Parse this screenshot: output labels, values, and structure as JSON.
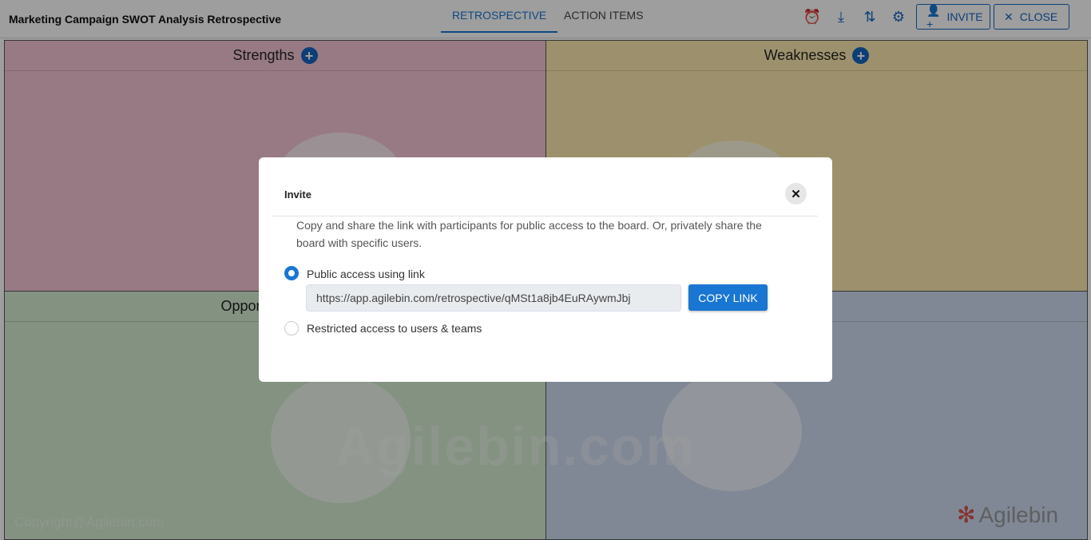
{
  "header": {
    "title": "Marketing Campaign SWOT Analysis Retrospective",
    "tabs": [
      {
        "label": "RETROSPECTIVE",
        "active": true
      },
      {
        "label": "ACTION ITEMS",
        "active": false
      }
    ],
    "icons": [
      "alarm-icon",
      "download-icon",
      "sort-icon",
      "gear-icon"
    ],
    "invite_label": "INVITE",
    "close_label": "CLOSE"
  },
  "board": {
    "quadrants": [
      {
        "label": "Strengths",
        "color": "#f5c6d6"
      },
      {
        "label": "Weaknesses",
        "color": "#fdebb0"
      },
      {
        "label": "Opportunities",
        "color": "#d3ecd0"
      },
      {
        "label": "",
        "color": "#cfdcf2"
      }
    ],
    "watermark": "Agilebin.com",
    "copyright": "Copyright@Agilebin.com",
    "logo": "Agilebin"
  },
  "modal": {
    "title": "Invite",
    "description": "Copy and share the link with participants for public access to the board. Or, privately share the board with specific users.",
    "options": [
      {
        "label": "Public access using link",
        "selected": true
      },
      {
        "label": "Restricted access to users & teams",
        "selected": false
      }
    ],
    "link": "https://app.agilebin.com/retrospective/qMSt1a8jb4EuRAywmJbj",
    "copy_label": "COPY LINK",
    "accent": "#1976d2"
  }
}
